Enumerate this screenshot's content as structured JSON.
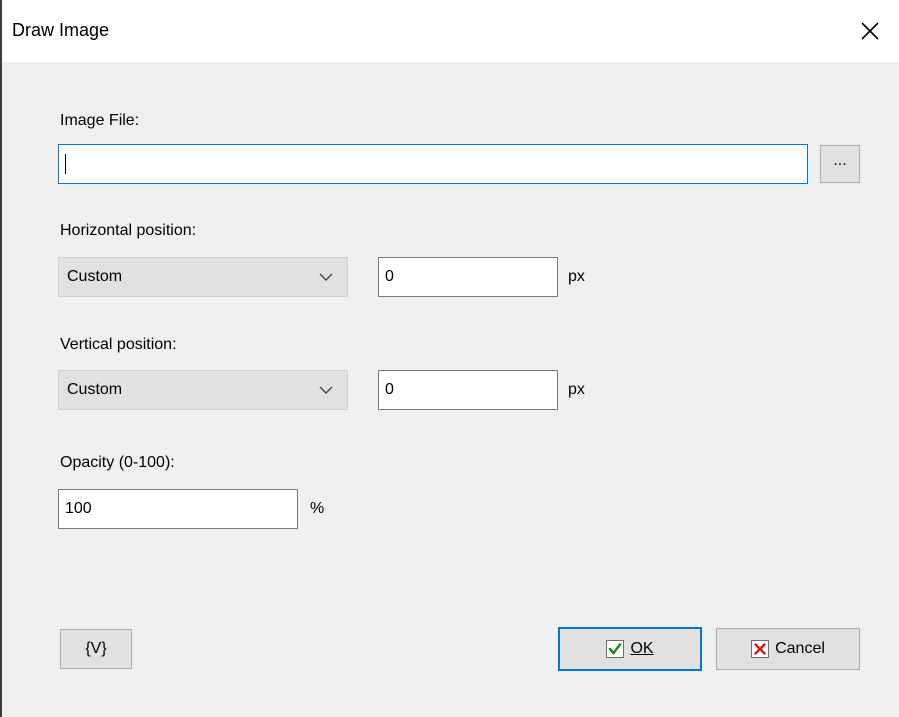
{
  "window": {
    "title": "Draw Image"
  },
  "image_file": {
    "label": "Image File:",
    "value": "",
    "browse_label": "..."
  },
  "horizontal": {
    "label": "Horizontal position:",
    "mode": "Custom",
    "value": "0",
    "unit": "px"
  },
  "vertical": {
    "label": "Vertical position:",
    "mode": "Custom",
    "value": "0",
    "unit": "px"
  },
  "opacity": {
    "label": "Opacity (0-100):",
    "value": "100",
    "unit": "%"
  },
  "buttons": {
    "variables_label": "{V}",
    "ok_label": "OK",
    "cancel_label": "Cancel"
  },
  "colors": {
    "accent": "#0078d7",
    "ok_check": "#1a8f1a",
    "cancel_x": "#d11a1a"
  }
}
